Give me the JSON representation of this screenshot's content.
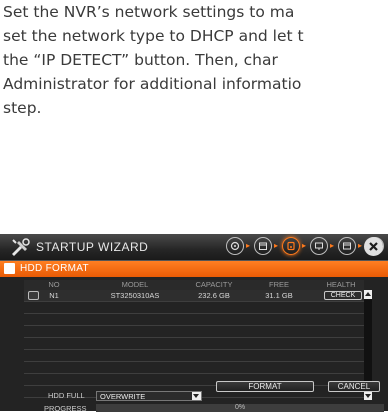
{
  "document": {
    "lines": [
      "Set the NVR’s network settings to ma",
      "set the network type to DHCP and let t",
      "the “IP DETECT” button. Then, char",
      "Administrator for additional informatio",
      "step."
    ]
  },
  "wizard": {
    "title": "STARTUP WIZARD",
    "steps": [
      "step-1",
      "step-2",
      "step-3",
      "step-4",
      "step-5",
      "step-6"
    ],
    "active_step": 3,
    "accent": "#ff7a1c",
    "section_title": "HDD FORMAT",
    "table": {
      "headers": [
        "NO",
        "MODEL",
        "CAPACITY",
        "FREE",
        "HEALTH"
      ],
      "rows": [
        {
          "no": "N1",
          "model": "ST3250310AS",
          "capacity": "232.6 GB",
          "free": "31.1 GB",
          "health_button": "CHECK"
        }
      ]
    },
    "format_button": "FORMAT",
    "cancel_button": "CANCEL",
    "hdd_full_label": "HDD FULL",
    "hdd_full_value": "OVERWRITE",
    "progress_label": "PROGRESS",
    "progress_value": 0,
    "progress_text": "0%"
  }
}
